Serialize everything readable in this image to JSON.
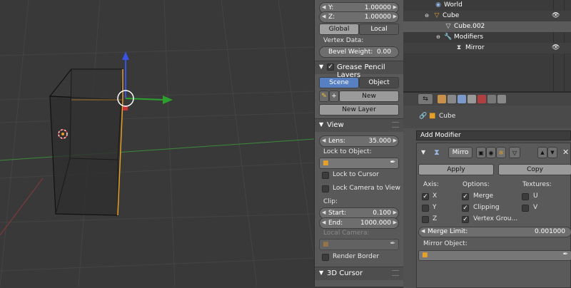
{
  "npanel": {
    "y_label": "Y:",
    "y_value": "1.00000",
    "z_label": "Z:",
    "z_value": "1.00000",
    "global_label": "Global",
    "local_label": "Local",
    "vertex_data_label": "Vertex Data:",
    "bevel_weight_label": "Bevel Weight:",
    "bevel_weight_value": "0.00",
    "grease_pencil_title": "Grease Pencil Layers",
    "scene_label": "Scene",
    "object_label": "Object",
    "new_label": "New",
    "new_layer_label": "New Layer",
    "view_title": "View",
    "lens_label": "Lens:",
    "lens_value": "35.000",
    "lock_to_object_label": "Lock to Object:",
    "lock_to_cursor_label": "Lock to Cursor",
    "lock_camera_label": "Lock Camera to View",
    "clip_label": "Clip:",
    "start_label": "Start:",
    "start_value": "0.100",
    "end_label": "End:",
    "end_value": "1000.000",
    "local_camera_label": "Local Camera:",
    "render_border_label": "Render Border",
    "cursor_title": "3D Cursor"
  },
  "outliner": {
    "world": "World",
    "cube": "Cube",
    "cube002": "Cube.002",
    "modifiers": "Modifiers",
    "mirror": "Mirror"
  },
  "props": {
    "breadcrumb_object": "Cube",
    "add_modifier": "Add Modifier",
    "modifier_name": "Mirro",
    "apply_label": "Apply",
    "copy_label": "Copy",
    "axis_label": "Axis:",
    "options_label": "Options:",
    "textures_label": "Textures:",
    "x_label": "X",
    "y_label": "Y",
    "z_label": "Z",
    "merge_label": "Merge",
    "clipping_label": "Clipping",
    "vertex_groups_label": "Vertex Grou...",
    "u_label": "U",
    "v_label": "V",
    "merge_limit_label": "Merge Limit:",
    "merge_limit_value": "0.001000",
    "mirror_object_label": "Mirror Object:"
  },
  "colors": {
    "accent_blue": "#5680c2",
    "axis_red": "#c83232",
    "axis_green": "#2ea02e",
    "axis_blue": "#3a52e0",
    "selection_orange": "#e6a028"
  }
}
